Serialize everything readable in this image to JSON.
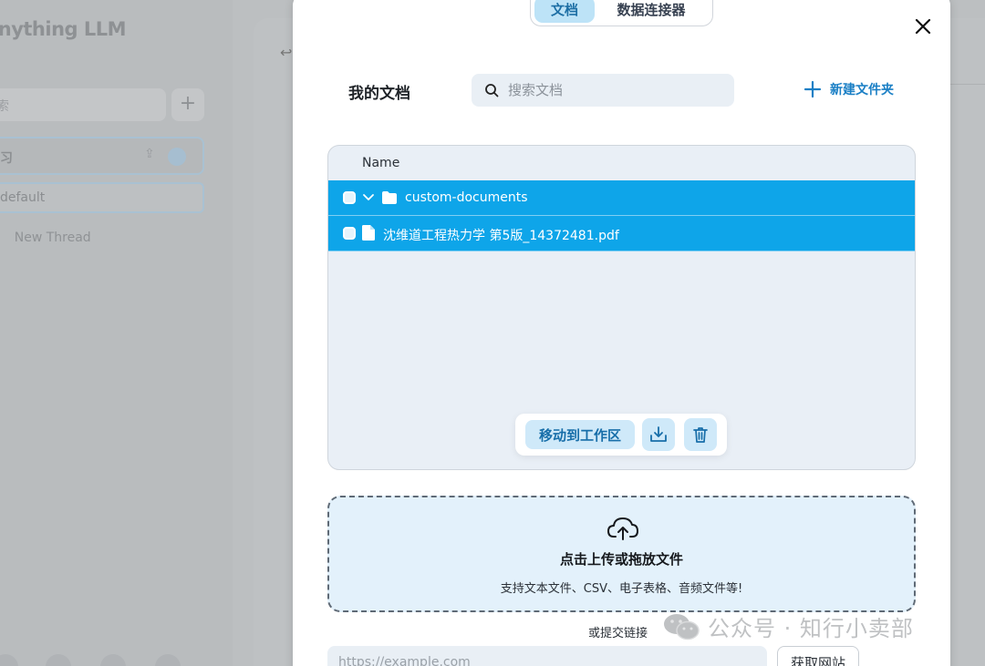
{
  "background": {
    "app_name": "Anything LLM",
    "search_placeholder": "搜索",
    "workspace_name": "学习",
    "thread_default": "default",
    "new_thread": "New Thread"
  },
  "modal": {
    "tabs": [
      {
        "label": "文档",
        "active": true
      },
      {
        "label": "数据连接器",
        "active": false
      }
    ],
    "title": "我的文档",
    "search_placeholder": "搜索文档",
    "new_folder_label": "新建文件夹",
    "file_list": {
      "column_header": "Name",
      "items": [
        {
          "type": "folder",
          "name": "custom-documents",
          "expanded": true,
          "selected": true
        },
        {
          "type": "file",
          "name": "沈维道工程热力学 第5版_14372481.pdf",
          "selected": true
        }
      ]
    },
    "actions": {
      "move_label": "移动到工作区",
      "download_icon": "download-tray-icon",
      "delete_icon": "trash-icon"
    },
    "upload": {
      "title": "点击上传或拖放文件",
      "subtitle": "支持文本文件、CSV、电子表格、音频文件等!"
    },
    "link_section": {
      "label": "或提交链接",
      "url_placeholder": "https://example.com",
      "fetch_label": "获取网站"
    }
  },
  "watermark": {
    "text": "公众号 · 知行小卖部"
  },
  "colors": {
    "accent": "#0ea5e9",
    "accent_text": "#1a7fc5",
    "tab_active_bg": "#bde3f7",
    "upload_bg": "#e3f1fb"
  }
}
